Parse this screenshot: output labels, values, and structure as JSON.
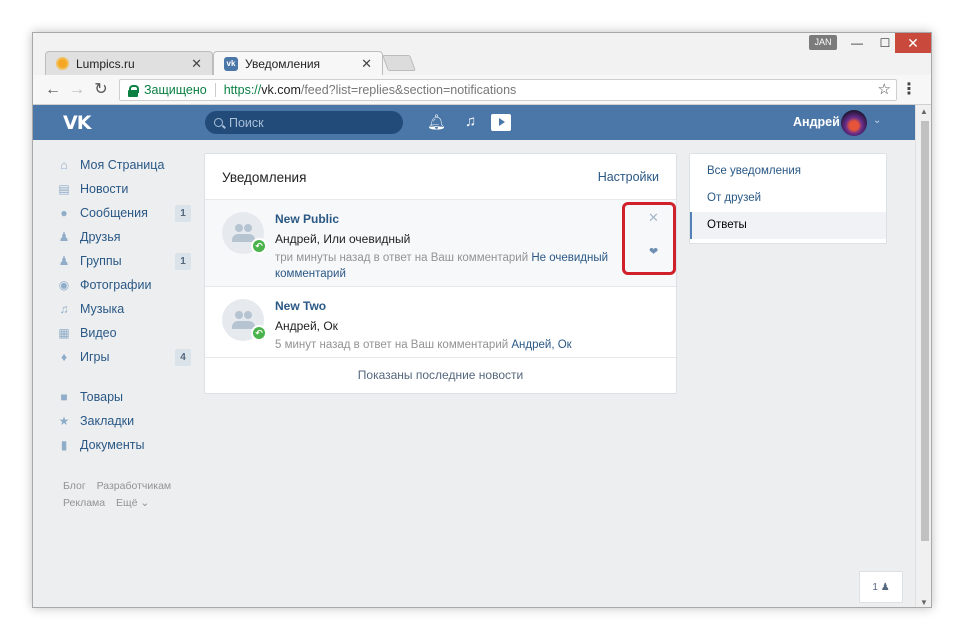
{
  "window": {
    "user_badge": "JAN",
    "minimize_icon": "minimize-icon",
    "maximize_icon": "maximize-icon",
    "close_icon": "close-icon"
  },
  "tabs": [
    {
      "title": "Lumpics.ru",
      "active": false,
      "icon": "lumpics-favicon"
    },
    {
      "title": "Уведомления",
      "active": true,
      "icon": "vk-favicon"
    }
  ],
  "toolbar": {
    "secure_label": "Защищено",
    "url_scheme": "https://",
    "url_host": "vk.com",
    "url_path": "/feed?list=replies&section=notifications"
  },
  "header": {
    "logo": "VK",
    "search_placeholder": "Поиск",
    "user_name": "Андрей"
  },
  "sidebar": {
    "items": [
      {
        "label": "Моя Страница",
        "icon": "home-icon",
        "badge": ""
      },
      {
        "label": "Новости",
        "icon": "news-icon",
        "badge": ""
      },
      {
        "label": "Сообщения",
        "icon": "messages-icon",
        "badge": "1"
      },
      {
        "label": "Друзья",
        "icon": "friend-icon",
        "badge": ""
      },
      {
        "label": "Группы",
        "icon": "groups-icon",
        "badge": "1"
      },
      {
        "label": "Фотографии",
        "icon": "camera-icon",
        "badge": ""
      },
      {
        "label": "Музыка",
        "icon": "music-icon",
        "badge": ""
      },
      {
        "label": "Видео",
        "icon": "film-icon",
        "badge": ""
      },
      {
        "label": "Игры",
        "icon": "gamepad-icon",
        "badge": "4"
      }
    ],
    "extra": [
      {
        "label": "Товары",
        "icon": "bag-icon"
      },
      {
        "label": "Закладки",
        "icon": "star-icon"
      },
      {
        "label": "Документы",
        "icon": "document-icon"
      }
    ],
    "footer": {
      "blog": "Блог",
      "developers": "Разработчикам",
      "ads": "Реклама",
      "more": "Ещё ⌄"
    }
  },
  "feed": {
    "title": "Уведомления",
    "settings": "Настройки",
    "notifications": [
      {
        "group": "New Public",
        "who": "Андрей, Или очевидный",
        "meta": "три минуты назад в ответ на Ваш комментарий",
        "link": "Не очевидный комментарий"
      },
      {
        "group": "New Two",
        "who": "Андрей, Ок",
        "meta": "5 минут назад в ответ на Ваш комментарий",
        "link": "Андрей, Ок"
      }
    ],
    "footer": "Показаны последние новости"
  },
  "filters": {
    "items": [
      {
        "label": "Все уведомления",
        "active": false
      },
      {
        "label": "От друзей",
        "active": false
      },
      {
        "label": "Ответы",
        "active": true
      }
    ]
  },
  "chat": {
    "count": "1"
  },
  "colors": {
    "vk_blue": "#4a76a8",
    "link": "#2a5885",
    "highlight": "#d0202a",
    "reply_green": "#4bb34b"
  }
}
